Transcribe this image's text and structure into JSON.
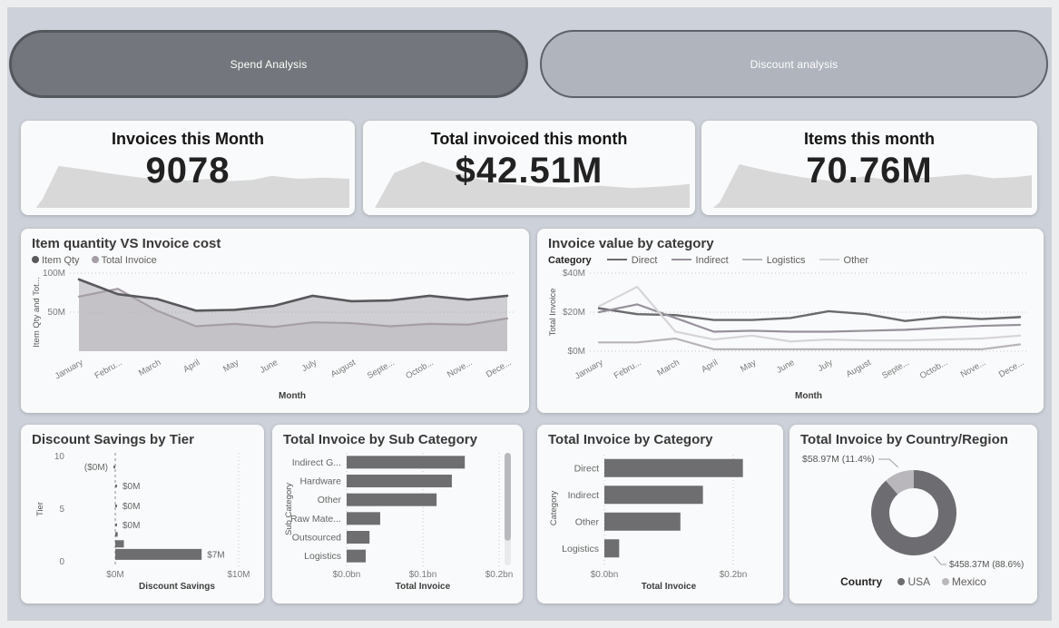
{
  "colors": {
    "canvas_bg": "#cdd2da",
    "card_bg": "#f9fafb",
    "pill_active_bg": "#73767c",
    "pill_active_border": "#54575c",
    "pill_inactive_bg": "#afb4bd",
    "pill_inactive_border": "#5e6167",
    "spark": "#d8d8d8",
    "bar": "#6e6e70",
    "grid": "#c5c5c5"
  },
  "nav": {
    "spend_label": "Spend Analysis",
    "discount_label": "Discount analysis"
  },
  "kpis": [
    {
      "title": "Invoices this Month",
      "value": "9078",
      "spark": [
        [
          3,
          100
        ],
        [
          5,
          85
        ],
        [
          10,
          28
        ],
        [
          18,
          34
        ],
        [
          26,
          41
        ],
        [
          34,
          47
        ],
        [
          42,
          52
        ],
        [
          50,
          53
        ],
        [
          57,
          50
        ],
        [
          63,
          54
        ],
        [
          70,
          52
        ],
        [
          76,
          45
        ],
        [
          84,
          50
        ],
        [
          92,
          48
        ],
        [
          100,
          50
        ]
      ]
    },
    {
      "title": "Total invoiced this month",
      "value": "$42.51M",
      "spark": [
        [
          2,
          100
        ],
        [
          8,
          40
        ],
        [
          17,
          20
        ],
        [
          24,
          32
        ],
        [
          32,
          48
        ],
        [
          42,
          58
        ],
        [
          52,
          63
        ],
        [
          62,
          65
        ],
        [
          72,
          62
        ],
        [
          82,
          66
        ],
        [
          92,
          63
        ],
        [
          100,
          59
        ]
      ]
    },
    {
      "title": "Items this month",
      "value": "70.76M",
      "spark": [
        [
          2,
          100
        ],
        [
          4,
          90
        ],
        [
          10,
          25
        ],
        [
          20,
          38
        ],
        [
          30,
          48
        ],
        [
          40,
          55
        ],
        [
          48,
          46
        ],
        [
          56,
          52
        ],
        [
          64,
          49
        ],
        [
          72,
          46
        ],
        [
          80,
          42
        ],
        [
          88,
          49
        ],
        [
          95,
          47
        ],
        [
          100,
          44
        ]
      ]
    }
  ],
  "chart_data": [
    {
      "type": "area",
      "title": "Item quantity VS Invoice cost",
      "x_labels": [
        "January",
        "Febru...",
        "March",
        "April",
        "May",
        "June",
        "July",
        "August",
        "Septe...",
        "Octob...",
        "Nove...",
        "Dece..."
      ],
      "xlabel": "Month",
      "ylabel": "Item Qty and Tot...",
      "ylim": [
        0,
        100
      ],
      "yticks": [
        {
          "v": 50,
          "label": "50M"
        },
        {
          "v": 100,
          "label": "100M"
        }
      ],
      "series": [
        {
          "name": "Item Qty",
          "color": "#59585c",
          "fill": "#9b9aa0",
          "values": [
            92,
            73,
            67,
            52,
            53,
            58,
            71,
            64,
            65,
            71,
            66,
            71
          ]
        },
        {
          "name": "Total Invoice",
          "color": "#a59ea6",
          "fill": "#b9b3ba",
          "values": [
            70,
            80,
            52,
            32,
            35,
            31,
            37,
            36,
            32,
            35,
            34,
            42
          ]
        }
      ]
    },
    {
      "type": "line",
      "title": "Invoice value by category",
      "legend_title": "Category",
      "x_labels": [
        "January",
        "Febru...",
        "March",
        "April",
        "May",
        "June",
        "July",
        "August",
        "Septe...",
        "Octob...",
        "Nove...",
        "Dece..."
      ],
      "xlabel": "Month",
      "ylabel": "Total Invoice",
      "ylim": [
        0,
        40
      ],
      "yticks": [
        {
          "v": 0,
          "label": "$0M"
        },
        {
          "v": 20,
          "label": "$20M"
        },
        {
          "v": 40,
          "label": "$40M"
        }
      ],
      "series": [
        {
          "name": "Direct",
          "color": "#6b6a6e",
          "values": [
            22,
            19,
            18.5,
            16,
            16,
            17,
            20.5,
            19,
            15.5,
            17.5,
            16.5,
            17.5
          ]
        },
        {
          "name": "Indirect",
          "color": "#96919a",
          "values": [
            20,
            24,
            17,
            10,
            10.5,
            10,
            10,
            10.5,
            11,
            12,
            13,
            13.5
          ]
        },
        {
          "name": "Logistics",
          "color": "#b7b4ba",
          "values": [
            4.5,
            4.5,
            6.5,
            1,
            1,
            1,
            1,
            1,
            1,
            1,
            1,
            3.5
          ]
        },
        {
          "name": "Other",
          "color": "#d6d4d7",
          "values": [
            23,
            33,
            10,
            6,
            8,
            5,
            6,
            5.5,
            5.5,
            6,
            6.5,
            8
          ]
        }
      ]
    },
    {
      "type": "bar",
      "title": "Discount Savings by Tier",
      "xlabel": "Discount Savings",
      "ylabel": "Tier",
      "xlim": [
        0,
        10
      ],
      "xticks": [
        {
          "v": 0,
          "label": "$0M"
        },
        {
          "v": 10,
          "label": "$10M"
        }
      ],
      "yticks": [
        {
          "v": 10,
          "label": "10"
        },
        {
          "v": 5,
          "label": "5"
        },
        {
          "v": 0,
          "label": "0"
        }
      ],
      "bars": [
        {
          "tier": 9,
          "value": -0.05,
          "label": "($0M)"
        },
        {
          "tier": 7.2,
          "value": 0.05,
          "label": "$0M"
        },
        {
          "tier": 5.3,
          "value": 0.05,
          "label": "$0M"
        },
        {
          "tier": 3.5,
          "value": 0.05,
          "label": "$0M"
        },
        {
          "tier": 2.6,
          "value": 0.2,
          "label": ""
        },
        {
          "tier": 1.7,
          "value": 0.7,
          "label": ""
        },
        {
          "tier": 0.7,
          "value": 7,
          "label": "$7M"
        }
      ]
    },
    {
      "type": "bar",
      "title": "Total Invoice by Sub Category",
      "xlabel": "Total Invoice",
      "ylabel": "Sub Category",
      "categories": [
        "Indirect G...",
        "Hardware",
        "Other",
        "Raw Mate...",
        "Outsourced",
        "Logistics"
      ],
      "values": [
        0.155,
        0.138,
        0.118,
        0.044,
        0.03,
        0.025
      ],
      "xticks": [
        {
          "v": 0,
          "label": "$0.0bn"
        },
        {
          "v": 0.1,
          "label": "$0.1bn"
        },
        {
          "v": 0.2,
          "label": "$0.2bn"
        }
      ],
      "tick_max": 0.2,
      "scrollbar": true
    },
    {
      "type": "bar",
      "title": "Total Invoice by Category",
      "xlabel": "Total Invoice",
      "ylabel": "Category",
      "categories": [
        "Direct",
        "Indirect",
        "Other",
        "Logistics"
      ],
      "values": [
        0.215,
        0.153,
        0.118,
        0.023
      ],
      "xticks": [
        {
          "v": 0,
          "label": "$0.0bn"
        },
        {
          "v": 0.2,
          "label": "$0.2bn"
        }
      ],
      "tick_max": 0.2,
      "scrollbar": false
    },
    {
      "type": "donut",
      "title": "Total Invoice by Country/Region",
      "legend_title": "Country",
      "slices": [
        {
          "name": "USA",
          "label": "$458.37M (88.6%)",
          "pct": 88.6,
          "color": "#6d6d71"
        },
        {
          "name": "Mexico",
          "label": "$58.97M (11.4%)",
          "pct": 11.4,
          "color": "#b9b7bc"
        }
      ]
    }
  ]
}
